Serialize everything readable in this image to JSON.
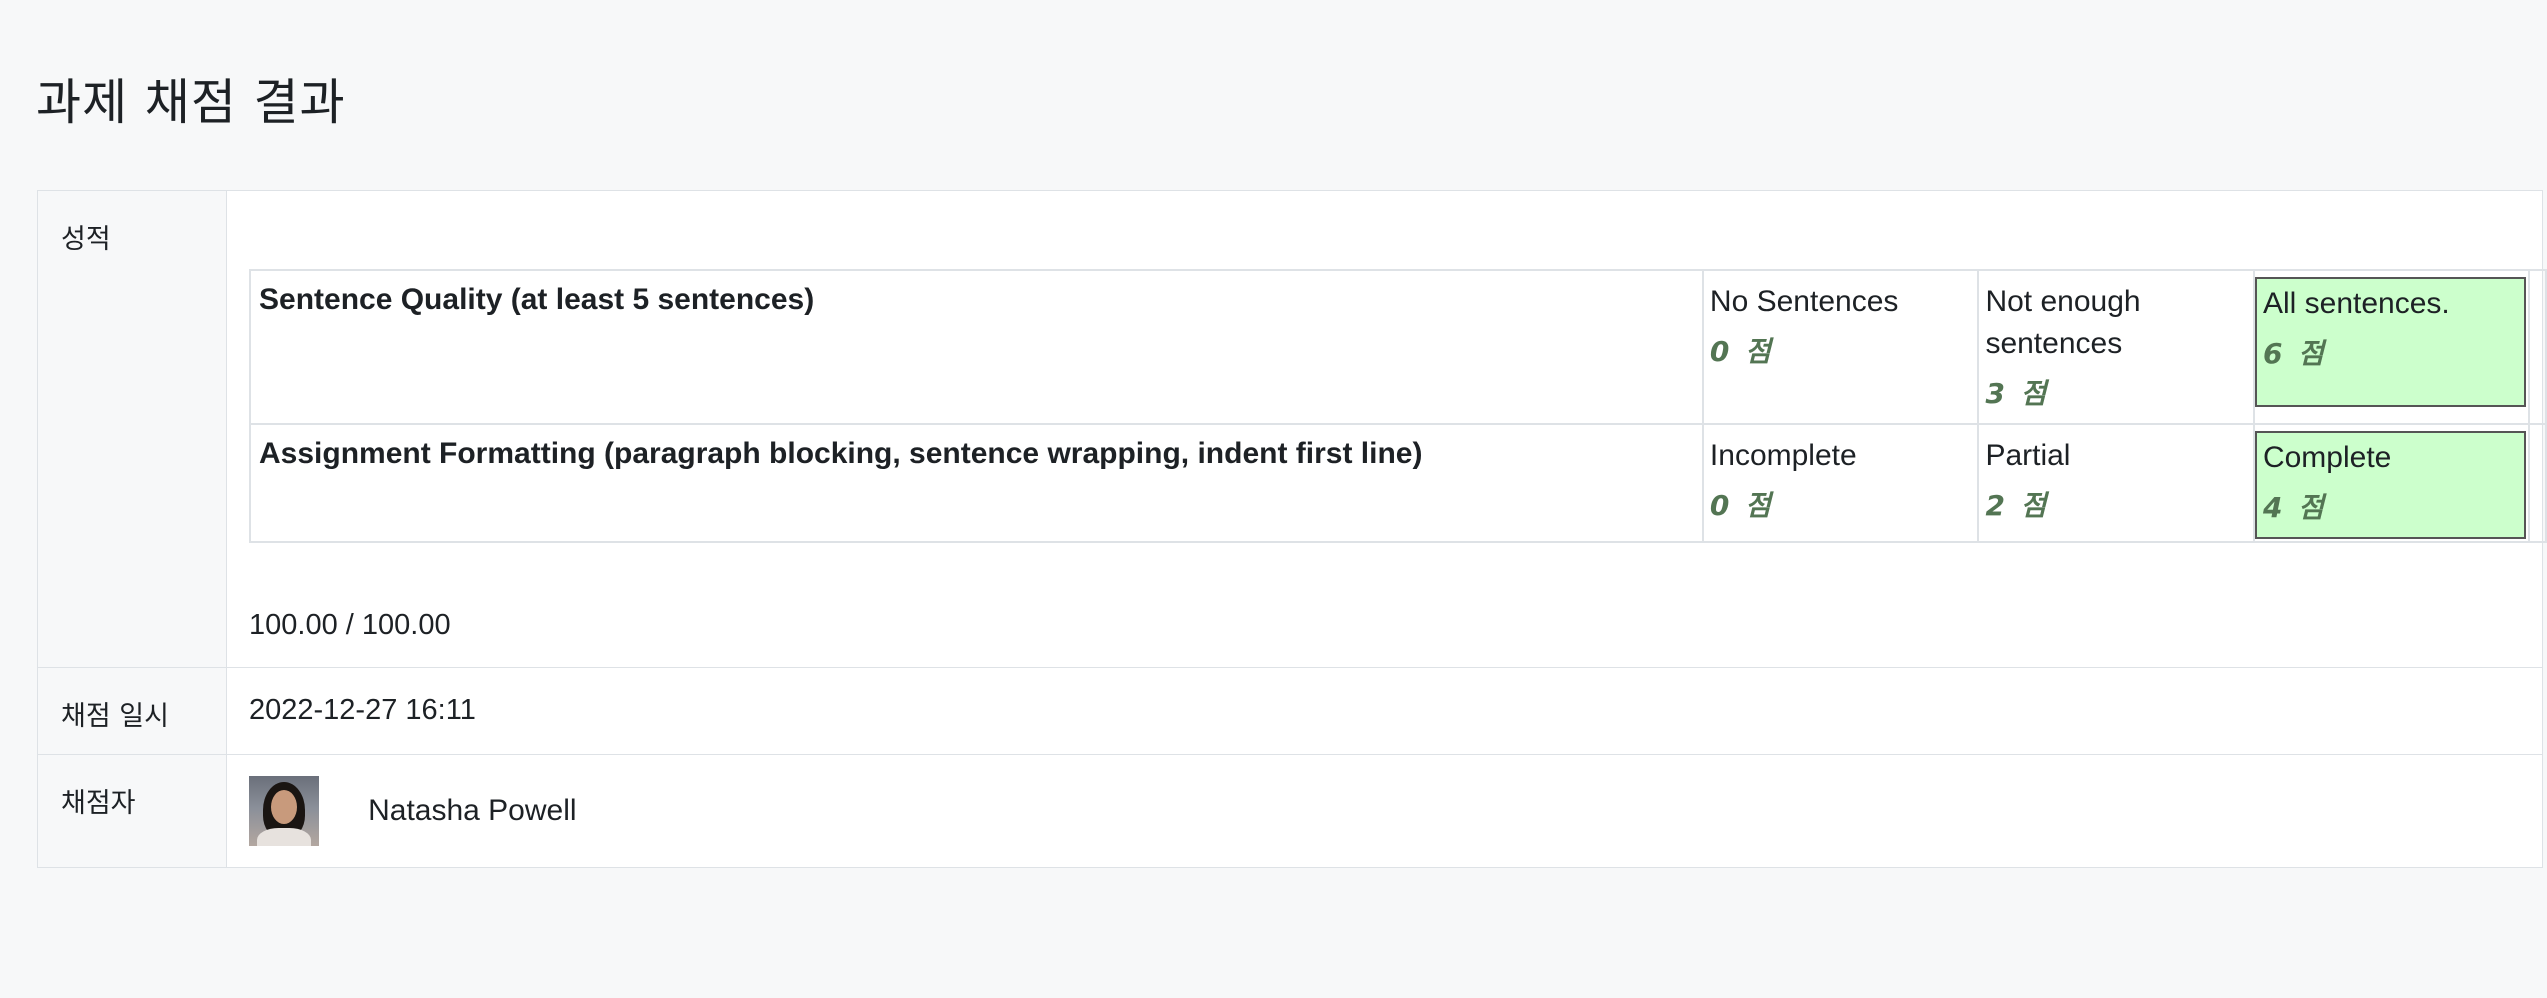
{
  "page": {
    "title": "과제 채점 결과"
  },
  "labels": {
    "grade": "성적",
    "graded_on": "채점 일시",
    "graded_by": "채점자"
  },
  "rubric": {
    "criteria": [
      {
        "description": "Sentence Quality (at least 5 sentences)",
        "levels": [
          {
            "definition": "No Sentences",
            "score": "0 점",
            "selected": false
          },
          {
            "definition": "Not enough sentences",
            "score": "3 점",
            "selected": false
          },
          {
            "definition": "All sentences.",
            "score": "6 점",
            "selected": true
          }
        ]
      },
      {
        "description": "Assignment Formatting (paragraph blocking, sentence wrapping, indent first line)",
        "levels": [
          {
            "definition": "Incomplete",
            "score": "0 점",
            "selected": false
          },
          {
            "definition": "Partial",
            "score": "2 점",
            "selected": false
          },
          {
            "definition": "Complete",
            "score": "4 점",
            "selected": true
          }
        ]
      }
    ]
  },
  "grade_total": "100.00 / 100.00",
  "graded_on": "2022-12-27 16:11",
  "grader": {
    "name": "Natasha Powell"
  },
  "colors": {
    "selected_level_bg": "#ccffcc",
    "score_text": "#537553"
  }
}
